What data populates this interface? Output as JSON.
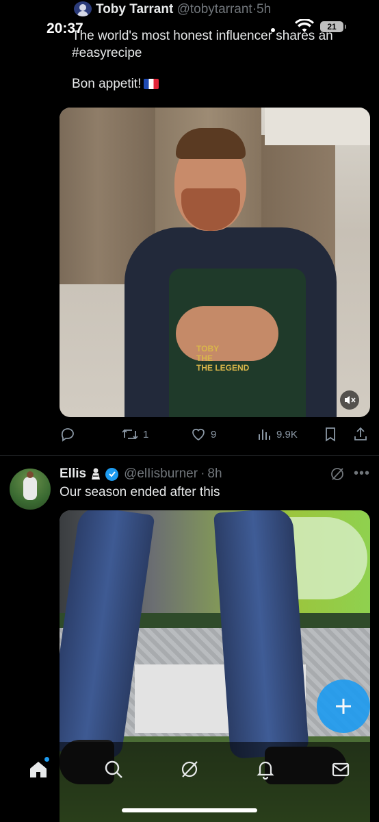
{
  "status_bar": {
    "time": "20:37",
    "battery": "21"
  },
  "tweet1": {
    "name": "Toby Tarrant",
    "handle": "@tobytarrant",
    "time": "5h",
    "text_line1": "The world's most honest influencer shares an #easyrecipe",
    "text_line2": "Bon appetit!",
    "apron_text": "TOBY\nTHE\nTHE LEGEND",
    "actions": {
      "reply_count": "",
      "retweet_count": "1",
      "like_count": "9",
      "views_count": "9.9K"
    }
  },
  "tweet2": {
    "name": "Ellis",
    "handle": "@elIisburner",
    "time": "8h",
    "text": "Our season ended after this"
  },
  "colors": {
    "accent": "#1d9bf0",
    "background": "#000000",
    "muted_text": "#71767b"
  },
  "icons": {
    "nav": [
      "home-icon",
      "search-icon",
      "grok-icon",
      "bell-icon",
      "mail-icon"
    ],
    "tweet_actions": [
      "reply-icon",
      "retweet-icon",
      "heart-icon",
      "views-icon",
      "bookmark-icon",
      "share-icon"
    ]
  }
}
